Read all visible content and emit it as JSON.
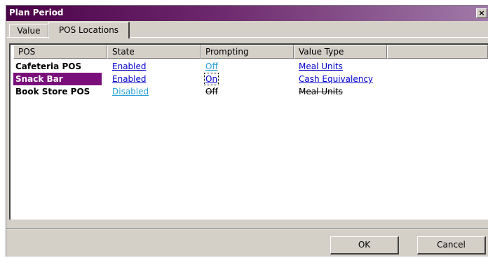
{
  "window": {
    "title": "Plan Period",
    "close_glyph": "×"
  },
  "tabs": [
    {
      "label": "Value",
      "active": false
    },
    {
      "label": "POS Locations",
      "active": true
    }
  ],
  "table": {
    "columns": [
      "POS",
      "State",
      "Prompting",
      "Value Type"
    ],
    "rows": [
      {
        "pos": "Cafeteria POS",
        "state": "Enabled",
        "prompting": "Off",
        "value_type": "Meal Units",
        "selected": false,
        "disabled": false
      },
      {
        "pos": "Snack Bar",
        "state": "Enabled",
        "prompting": "On",
        "value_type": "Cash Equivalency",
        "selected": true,
        "disabled": false
      },
      {
        "pos": "Book Store POS",
        "state": "Disabled",
        "prompting": "Off",
        "value_type": "Meal Units",
        "selected": false,
        "disabled": true
      }
    ]
  },
  "buttons": {
    "ok_label": "OK",
    "cancel_label": "Cancel"
  },
  "colors": {
    "title_gradient_start": "#4a0048",
    "selection": "#7a0f7c",
    "link": "#0000cc",
    "link_off": "#2aa0d8"
  }
}
